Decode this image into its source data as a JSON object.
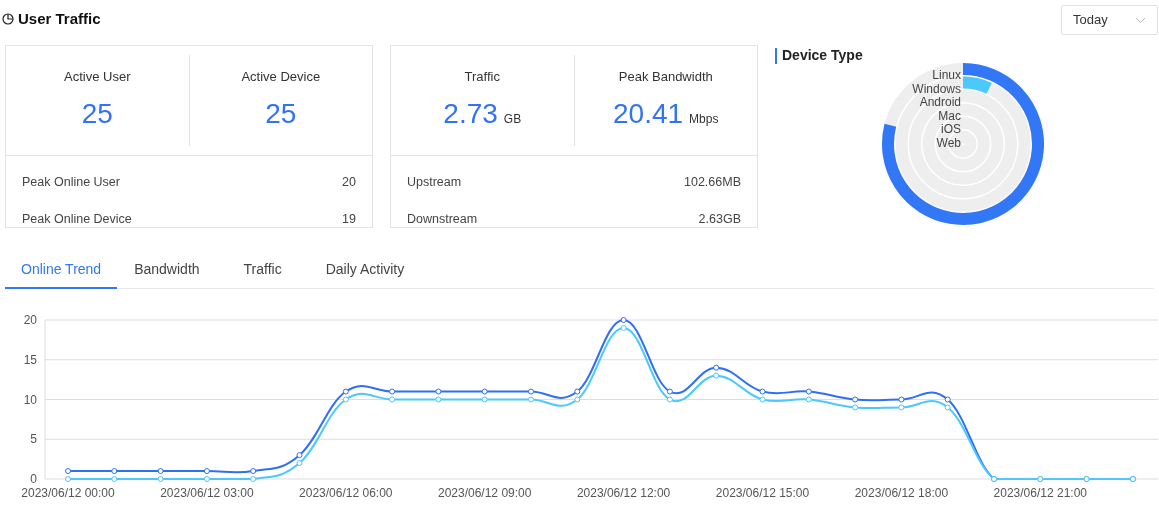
{
  "header": {
    "title": "User Traffic",
    "range": "Today"
  },
  "cards": [
    {
      "metrics": [
        {
          "label": "Active User",
          "value": "25"
        },
        {
          "label": "Active Device",
          "value": "25"
        }
      ],
      "rows": [
        {
          "label": "Peak Online User",
          "value": "20"
        },
        {
          "label": "Peak Online Device",
          "value": "19"
        }
      ]
    },
    {
      "metrics": [
        {
          "label": "Traffic",
          "value": "2.73",
          "unit": "GB"
        },
        {
          "label": "Peak Bandwidth",
          "value": "20.41",
          "unit": "Mbps"
        }
      ],
      "rows": [
        {
          "label": "Upstream",
          "value": "102.66MB"
        },
        {
          "label": "Downstream",
          "value": "2.63GB"
        }
      ]
    }
  ],
  "device_type": {
    "title": "Device Type",
    "items": [
      {
        "label": "Linux",
        "color": "#3177f6"
      },
      {
        "label": "Windows",
        "color": "#4cc8fc"
      },
      {
        "label": "Android"
      },
      {
        "label": "Mac"
      },
      {
        "label": "iOS"
      },
      {
        "label": "Web"
      }
    ]
  },
  "tabs": [
    {
      "label": "Online Trend",
      "selected": true
    },
    {
      "label": "Bandwidth",
      "selected": false
    },
    {
      "label": "Traffic",
      "selected": false
    },
    {
      "label": "Daily Activity",
      "selected": false
    }
  ],
  "chart_data": {
    "type": "line",
    "categories": [
      "2023/06/12 00:00",
      null,
      null,
      "2023/06/12 03:00",
      null,
      null,
      "2023/06/12 06:00",
      null,
      null,
      "2023/06/12 09:00",
      null,
      null,
      "2023/06/12 12:00",
      null,
      null,
      "2023/06/12 15:00",
      null,
      null,
      "2023/06/12 18:00",
      null,
      null,
      "2023/06/12 21:00",
      null,
      null
    ],
    "ylim": [
      0,
      20
    ],
    "yticks": [
      0,
      5,
      10,
      15,
      20
    ],
    "grid": true,
    "series": [
      {
        "color": "#2f6ff5",
        "marker": "circle",
        "values": [
          1,
          1,
          1,
          1,
          1,
          3,
          11,
          11,
          11,
          11,
          11,
          11,
          20,
          11,
          14,
          11,
          11,
          10,
          10,
          10,
          0,
          0,
          0,
          0
        ]
      },
      {
        "color": "#4cc8fc",
        "marker": "circle",
        "values": [
          0,
          0,
          0,
          0,
          0,
          2,
          10,
          10,
          10,
          10,
          10,
          10,
          19,
          10,
          13,
          10,
          10,
          9,
          9,
          9,
          0,
          0,
          0,
          0
        ]
      }
    ]
  }
}
